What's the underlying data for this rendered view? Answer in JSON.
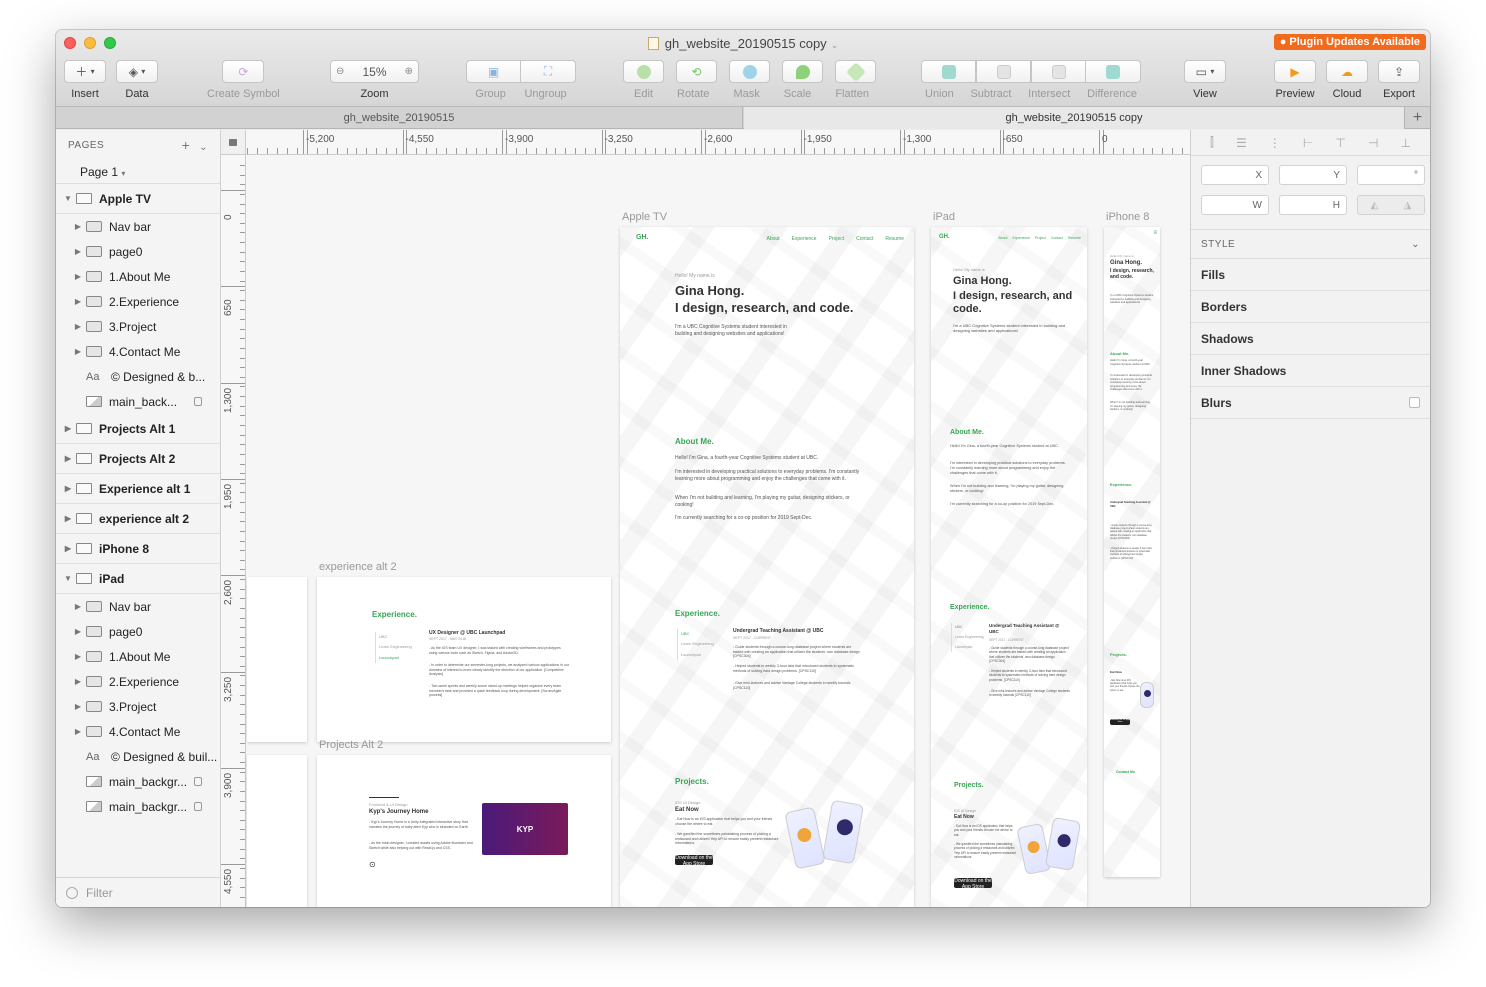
{
  "window": {
    "title": "gh_website_20190515 copy",
    "plugin_badge": "Plugin Updates Available"
  },
  "toolbar": {
    "insert": "Insert",
    "data": "Data",
    "create_symbol": "Create Symbol",
    "zoom_label": "Zoom",
    "zoom_value": "15%",
    "group": "Group",
    "ungroup": "Ungroup",
    "edit": "Edit",
    "rotate": "Rotate",
    "mask": "Mask",
    "scale": "Scale",
    "flatten": "Flatten",
    "union": "Union",
    "subtract": "Subtract",
    "intersect": "Intersect",
    "difference": "Difference",
    "view": "View",
    "preview": "Preview",
    "cloud": "Cloud",
    "export": "Export"
  },
  "tabs": [
    "gh_website_20190515",
    "gh_website_20190515 copy"
  ],
  "sidebar": {
    "pages_header": "PAGES",
    "current_page": "Page 1",
    "filter_placeholder": "Filter",
    "layers": [
      {
        "label": "Apple TV",
        "kind": "artboard",
        "open": true
      },
      {
        "label": "Nav bar",
        "kind": "folder"
      },
      {
        "label": "page0",
        "kind": "folder"
      },
      {
        "label": "1.About Me",
        "kind": "folder"
      },
      {
        "label": "2.Experience",
        "kind": "folder"
      },
      {
        "label": "3.Project",
        "kind": "folder"
      },
      {
        "label": "4.Contact Me",
        "kind": "folder"
      },
      {
        "label": "© Designed & b...",
        "kind": "text"
      },
      {
        "label": "main_back...",
        "kind": "image",
        "locked": true
      },
      {
        "label": "Projects Alt 1",
        "kind": "artboard"
      },
      {
        "label": "Projects Alt 2",
        "kind": "artboard"
      },
      {
        "label": "Experience alt 1",
        "kind": "artboard"
      },
      {
        "label": "experience alt 2",
        "kind": "artboard"
      },
      {
        "label": "iPhone 8",
        "kind": "artboard"
      },
      {
        "label": "iPad",
        "kind": "artboard",
        "open": true
      },
      {
        "label": "Nav bar",
        "kind": "folder"
      },
      {
        "label": "page0",
        "kind": "folder"
      },
      {
        "label": "1.About Me",
        "kind": "folder"
      },
      {
        "label": "2.Experience",
        "kind": "folder"
      },
      {
        "label": "3.Project",
        "kind": "folder"
      },
      {
        "label": "4.Contact Me",
        "kind": "folder"
      },
      {
        "label": "© Designed & buil...",
        "kind": "text"
      },
      {
        "label": "main_backgr...",
        "kind": "image",
        "locked": true
      },
      {
        "label": "main_backgr...",
        "kind": "image",
        "locked": true
      }
    ]
  },
  "rulers": {
    "horizontal": [
      "-5,200",
      "-4,550",
      "-3,900",
      "-3,250",
      "-2,600",
      "-1,950",
      "-1,300",
      "-650",
      "0"
    ],
    "vertical": [
      "0",
      "650",
      "1,300",
      "1,950",
      "2,600",
      "3,250",
      "3,900",
      "4,550"
    ]
  },
  "artboards": {
    "apple_tv": "Apple TV",
    "ipad": "iPad",
    "iphone": "iPhone 8",
    "exp_alt2": "experience alt 2",
    "proj_alt2": "Projects Alt 2"
  },
  "site": {
    "logo": "GH.",
    "nav": [
      "About",
      "Experience",
      "Project",
      "Contact",
      "Resume"
    ],
    "hello": "Hello! My name is",
    "name": "Gina Hong.",
    "tagline": "I design, research, and code.",
    "intro": "I'm a UBC Cognitive Systems student interested in building and designing websites and applications!",
    "about_title": "About Me.",
    "about_1": "Hello! I'm Gina, a fourth-year Cognitive Systems student at UBC.",
    "about_2": "I'm interested in developing practical solutions to everyday problems. I'm constantly learning more about programming and enjoy the challenges that come with it.",
    "about_3": "When I'm not building and learning, I'm playing my guitar, designing stickers, or cooking!",
    "about_4": "I'm currently searching for a co-op position for 2019 Sept-Dec.",
    "exp_title": "Experience.",
    "exp_tabs": [
      "UBC",
      "Learn Engineering",
      "Launchpad"
    ],
    "exp_role": "Undergrad Teaching Assistant @ UBC",
    "exp_date": "SEPT 2017 - CURRENT",
    "exp_b1": "- Guide students through a course-long database project where students are tasked with creating an application that utilizes the students' own database design [CPSC304]",
    "exp_b2": "- Helped students in weekly 3-hour labs that introduced students to systematic methods of solving hard design problems. [CPSC110]",
    "exp_b3": "- Give mini-lectures and advise Vantage College students in weekly tutorials [CPSC110]",
    "proj_title": "Projects.",
    "proj_kicker": "iOS UI Design",
    "proj_name": "Eat Now",
    "proj_b1": "- Eat Now is an iOS application that helps you and your friends choose the where to eat.",
    "proj_b2": "- We gamified the sometimes painstaking process of picking a restaurant and utilized Yelp API to ensure easily present restaurant informations.",
    "appstore": "Download on the App Store",
    "alt_exp_role": "UX Designer @ UBC Launchpad",
    "alt_exp_date": "SEPT 2017 - MAY 2018",
    "alt_exp_b1": "- As the iOS team UX designer, I was tasked with creating wireframes and prototypes using various tools such as Sketch, Figma, and AdobeXD.",
    "alt_exp_b2": "- In order to determine our semester-long projects, we analyzed various applications in our domains of interest to more clearly identify the direction of our application. [Competitive Analysis]",
    "alt_exp_b3": "- Two-week sprints and weekly scrum stand-up meetings helped organize every team member's task and provided a quick feedback loop during development. [Scrum/Agile process]",
    "alt_proj_kicker": "Frontend & UI Design",
    "alt_proj_name": "Kyp's Journey Home",
    "alt_proj_b1": "- Kyp's Journey Home is a Unity-integrated interactive story that narrates the journey of baby alien Kyp who is stranded on Earth.",
    "alt_proj_b2": "- As the main designer, I created assets using Adobe Illustrator and Sketch while also helping out with React.js and CSS.",
    "kyp_logo": "KYP",
    "contact_title": "Contact Me."
  },
  "inspector": {
    "x": "X",
    "y": "Y",
    "rot": "°",
    "w": "W",
    "h": "H",
    "style_header": "STYLE",
    "fills": "Fills",
    "borders": "Borders",
    "shadows": "Shadows",
    "inner_shadows": "Inner Shadows",
    "blurs": "Blurs"
  }
}
